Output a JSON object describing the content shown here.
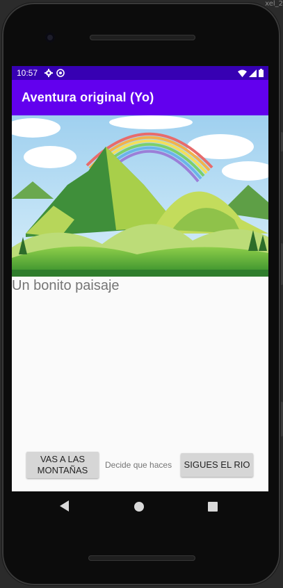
{
  "frame": {
    "device_label": "xel_2"
  },
  "status_bar": {
    "time": "10:57",
    "left_icons": [
      "gear-icon",
      "sync-icon"
    ],
    "right_icons": [
      "wifi-icon",
      "signal-icon",
      "battery-icon"
    ]
  },
  "app_bar": {
    "title": "Aventura original (Yo)"
  },
  "scene": {
    "description": "Un bonito paisaje"
  },
  "choices": {
    "left_label": "VAS A LAS MONTAÑAS",
    "prompt": "Decide que haces",
    "right_label": "SIGUES EL RIO"
  },
  "nav_bar": {
    "icons": [
      "back-icon",
      "home-icon",
      "recents-icon"
    ]
  },
  "colors": {
    "status_bar": "#3700b3",
    "app_bar": "#6200ee",
    "button": "#d6d6d6",
    "text_secondary": "#757575"
  }
}
